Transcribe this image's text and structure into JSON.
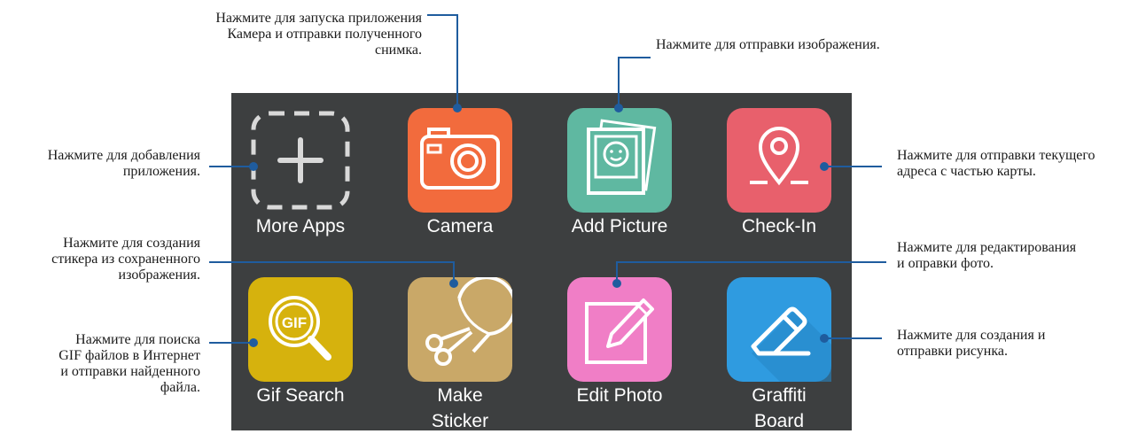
{
  "apps": [
    {
      "label": "More Apps",
      "icon": "plus-dashed-icon",
      "color": ""
    },
    {
      "label": "Camera",
      "icon": "camera-icon",
      "color": "#f26b3d"
    },
    {
      "label": "Add Picture",
      "icon": "photo-stack-icon",
      "color": "#5fb8a1"
    },
    {
      "label": "Check-In",
      "icon": "map-pin-icon",
      "color": "#e8606c"
    },
    {
      "label": "Gif Search",
      "icon": "gif-search-icon",
      "color": "#d6b20d"
    },
    {
      "label": "Make\nSticker",
      "icon": "scissors-icon",
      "color": "#c9a868"
    },
    {
      "label": "Edit Photo",
      "icon": "pencil-edit-icon",
      "color": "#f07ec6"
    },
    {
      "label": "Graffiti\nBoard",
      "icon": "eraser-icon",
      "color": "#2f9be0"
    }
  ],
  "callouts": {
    "more_apps": "Нажмите для добавления\nприложения.",
    "camera": "Нажмите для запуска приложения\nКамера и отправки полученного\nснимка.",
    "add_picture": "Нажмите для отправки изображения.",
    "check_in": "Нажмите для отправки текущего\nадреса с частью карты.",
    "make_sticker": "Нажмите для создания\nстикера из сохраненного\nизображения.",
    "edit_photo": "Нажмите для редактирования\nи оправки фото.",
    "gif_search": "Нажмите для поиска\nGIF файлов в Интернет\nи отправки найденного\nфайла.",
    "graffiti_board": "Нажмите для создания и\nотправки рисунка."
  },
  "colors": {
    "panel": "#3d3f40",
    "leader_line": "#1f5c9e"
  }
}
